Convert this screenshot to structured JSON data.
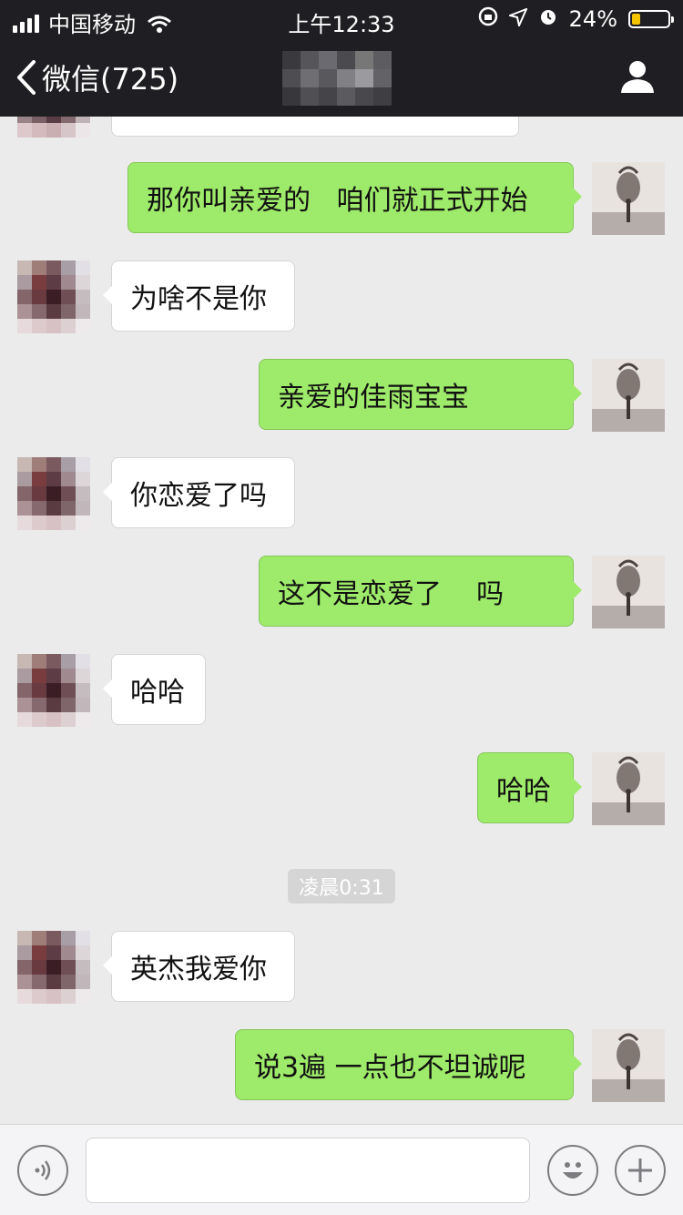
{
  "status_bar": {
    "carrier": "中国移动",
    "time": "上午12:33",
    "battery": "24%",
    "battery_level": 0.24
  },
  "nav": {
    "back_label": "微信(725)"
  },
  "messages": [
    {
      "side": "out",
      "text": "那你叫亲爱的   咱们就正式开始"
    },
    {
      "side": "in",
      "text": "为啥不是你"
    },
    {
      "side": "out",
      "text": "亲爱的佳雨宝宝"
    },
    {
      "side": "in",
      "text": "你恋爱了吗"
    },
    {
      "side": "out",
      "text": "这不是恋爱了    吗"
    },
    {
      "side": "in",
      "text": "哈哈"
    },
    {
      "side": "out",
      "text": "哈哈"
    },
    {
      "side": "in",
      "text": "英杰我爱你"
    },
    {
      "side": "out",
      "text": "说3遍 一点也不坦诚呢"
    }
  ],
  "timestamp": "凌晨0:31",
  "input_bar": {
    "message_value": "",
    "icons": [
      "voice-icon",
      "emoji-icon",
      "plus-icon"
    ]
  },
  "colors": {
    "nav_bg": "#1f1f23",
    "chat_bg": "#ebebeb",
    "outgoing_bubble": "#9eea6a",
    "incoming_bubble": "#ffffff",
    "battery_fill": "#f5c400"
  }
}
